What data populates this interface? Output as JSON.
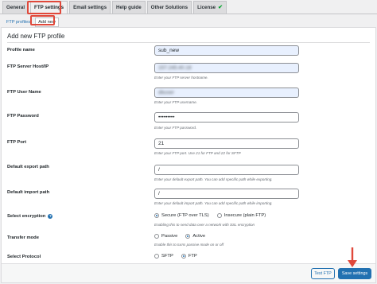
{
  "tabs": [
    {
      "label": "General"
    },
    {
      "label": "FTP settings"
    },
    {
      "label": "Email settings"
    },
    {
      "label": "Help guide"
    },
    {
      "label": "Other Solutions"
    },
    {
      "label": "License",
      "icon": "check-icon"
    }
  ],
  "subnav": {
    "ftp_profiles": "FTP profiles",
    "add_new": "Add new"
  },
  "section_title": "Add new FTP profile",
  "fields": {
    "profile_name": {
      "label": "Profile name",
      "value": "sub_new"
    },
    "host": {
      "label": "FTP Server Host/IP",
      "value": "157.245.40.18",
      "desc": "Enter your FTP server hostname."
    },
    "user": {
      "label": "FTP User Name",
      "value": "dbuser",
      "desc": "Enter your FTP username."
    },
    "password": {
      "label": "FTP Password",
      "value": "•••••••••",
      "desc": "Enter your FTP password."
    },
    "port": {
      "label": "FTP Port",
      "value": "21",
      "desc": "Enter your FTP port. Use 21 for FTP and 22 for SFTP"
    },
    "export_path": {
      "label": "Default export path",
      "value": "/",
      "desc": "Enter your default export path. You can add specific path while exporting."
    },
    "import_path": {
      "label": "Default import path",
      "value": "/",
      "desc": "Enter your default import path. You can add specific path while importing."
    }
  },
  "encryption": {
    "label": "Select encryption",
    "option_secure": "Secure (FTP over TLS)",
    "option_insecure": "Insecure (plain FTP)",
    "desc": "Enabling this to send data over a network with SSL encryption"
  },
  "transfer": {
    "label": "Transfer mode",
    "option_passive": "Passive",
    "option_active": "Active",
    "desc": "Enable this to turns passive mode on or off"
  },
  "protocol": {
    "label": "Select Protocol",
    "option_sftp": "SFTP",
    "option_ftp": "FTP"
  },
  "buttons": {
    "test": "Test FTP",
    "save": "Save settings"
  },
  "colors": {
    "accent": "#2271b1",
    "callout": "#e0483a",
    "success": "#00a32a"
  }
}
